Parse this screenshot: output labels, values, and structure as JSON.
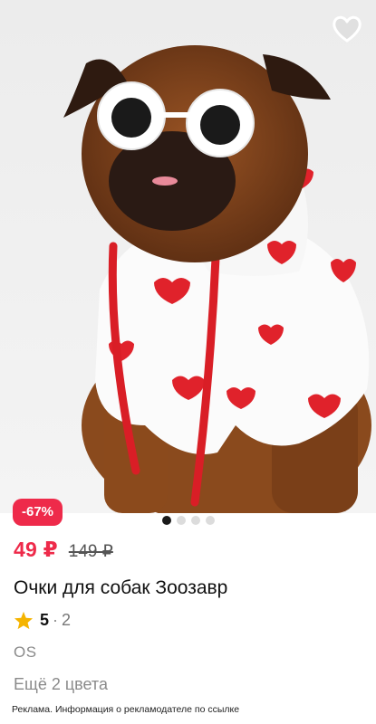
{
  "product": {
    "image_alt": "Dog wearing white flower sunglasses and white hoodie with red hearts",
    "discount_badge": "-67%",
    "price_current": "49 ₽",
    "price_old": "149 ₽",
    "title": "Очки для собак Зоозавр",
    "rating_score": "5",
    "rating_separator": "·",
    "rating_count": "2",
    "brand": "OS",
    "colors_text": "Ещё 2 цвета",
    "ad_disclaimer": "Реклама. Информация о рекламодателе по ссылке"
  },
  "carousel": {
    "total": 4,
    "active": 1
  },
  "icons": {
    "favorite": "heart-outline-icon",
    "rating": "star-icon"
  },
  "colors": {
    "accent": "#ee2a4a",
    "star": "#f5b400",
    "dot_active": "#1a1a1a",
    "dot_inactive": "#dcdcdc"
  }
}
